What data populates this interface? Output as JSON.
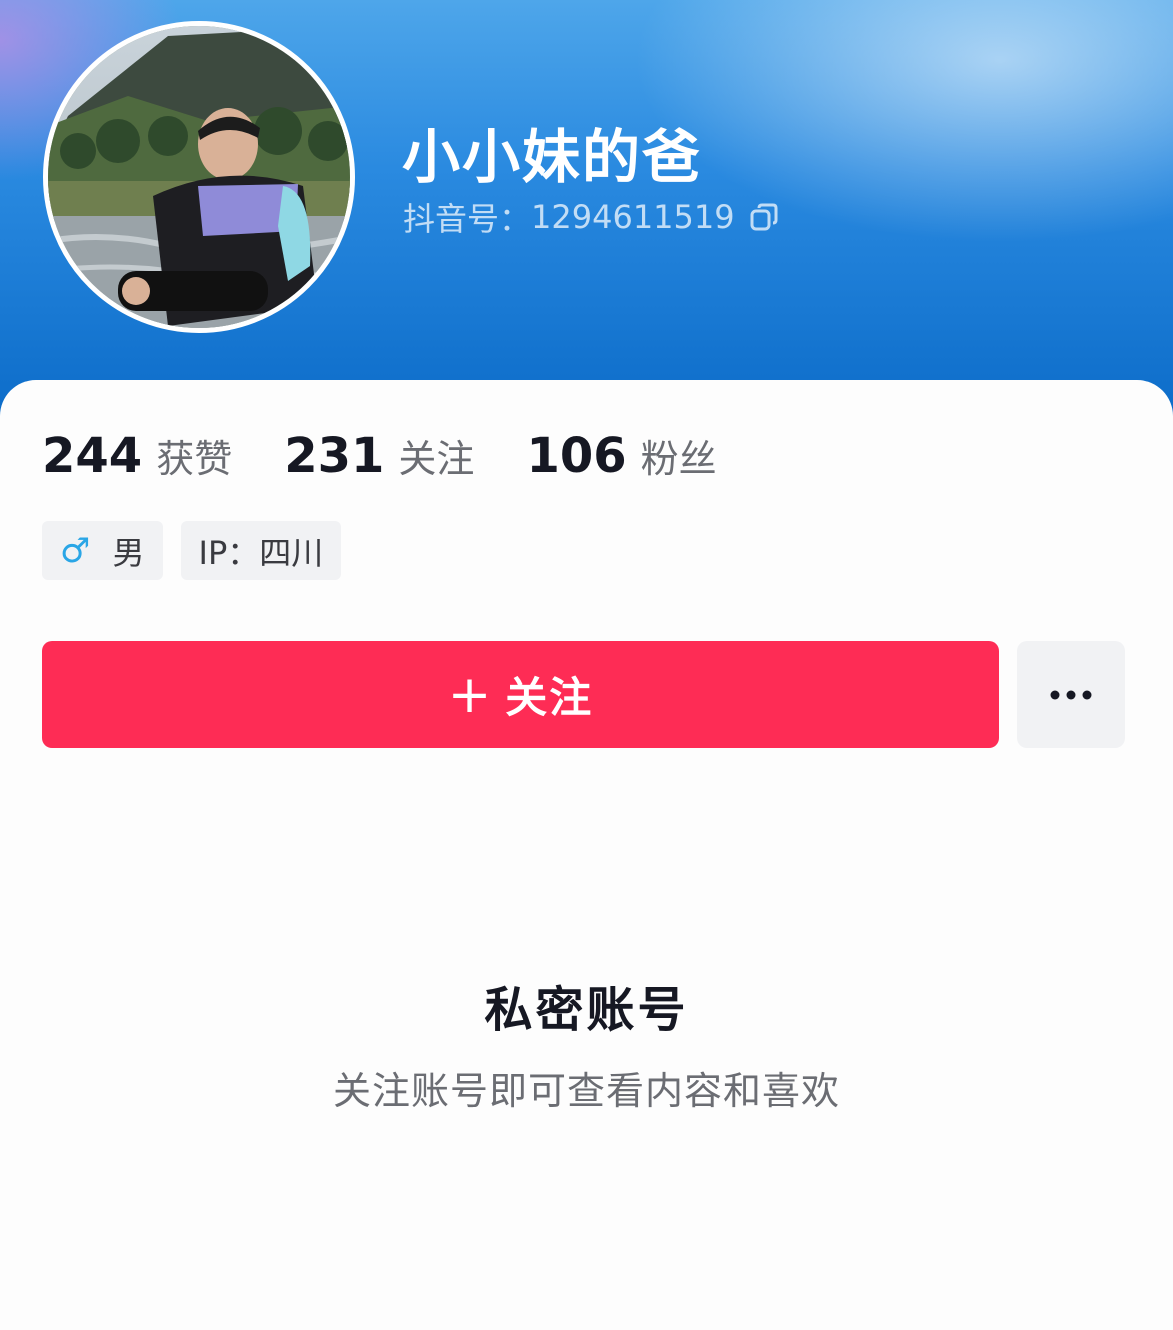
{
  "profile": {
    "username": "小小妹的爸",
    "douyin_id_label": "抖音号：",
    "douyin_id": "1294611519"
  },
  "stats": [
    {
      "value": "244",
      "label": "获赞"
    },
    {
      "value": "231",
      "label": "关注"
    },
    {
      "value": "106",
      "label": "粉丝"
    }
  ],
  "tags": {
    "gender_icon": "♂",
    "gender": "男",
    "ip": "IP：四川"
  },
  "actions": {
    "follow_plus": "+",
    "follow_label": "关注"
  },
  "privacy": {
    "title": "私密账号",
    "description": "关注账号即可查看内容和喜欢"
  },
  "colors": {
    "accent": "#fe2c55",
    "header_blue": "#0c6cc9",
    "male_icon": "#2aa6e6"
  }
}
